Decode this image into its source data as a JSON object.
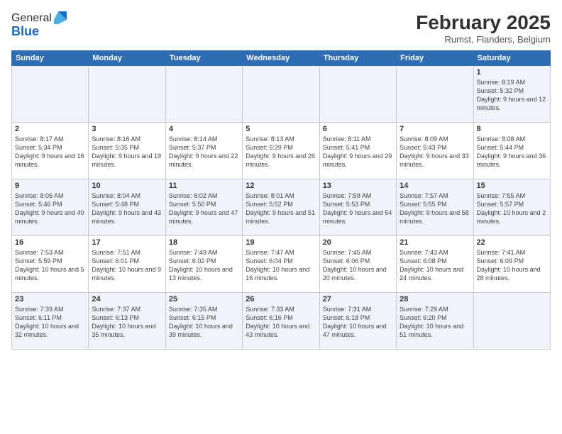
{
  "logo": {
    "general": "General",
    "blue": "Blue"
  },
  "title": "February 2025",
  "location": "Rumst, Flanders, Belgium",
  "days_of_week": [
    "Sunday",
    "Monday",
    "Tuesday",
    "Wednesday",
    "Thursday",
    "Friday",
    "Saturday"
  ],
  "weeks": [
    [
      {
        "day": "",
        "info": ""
      },
      {
        "day": "",
        "info": ""
      },
      {
        "day": "",
        "info": ""
      },
      {
        "day": "",
        "info": ""
      },
      {
        "day": "",
        "info": ""
      },
      {
        "day": "",
        "info": ""
      },
      {
        "day": "1",
        "info": "Sunrise: 8:19 AM\nSunset: 5:32 PM\nDaylight: 9 hours and 12 minutes."
      }
    ],
    [
      {
        "day": "2",
        "info": "Sunrise: 8:17 AM\nSunset: 5:34 PM\nDaylight: 9 hours and 16 minutes."
      },
      {
        "day": "3",
        "info": "Sunrise: 8:16 AM\nSunset: 5:35 PM\nDaylight: 9 hours and 19 minutes."
      },
      {
        "day": "4",
        "info": "Sunrise: 8:14 AM\nSunset: 5:37 PM\nDaylight: 9 hours and 22 minutes."
      },
      {
        "day": "5",
        "info": "Sunrise: 8:13 AM\nSunset: 5:39 PM\nDaylight: 9 hours and 26 minutes."
      },
      {
        "day": "6",
        "info": "Sunrise: 8:11 AM\nSunset: 5:41 PM\nDaylight: 9 hours and 29 minutes."
      },
      {
        "day": "7",
        "info": "Sunrise: 8:09 AM\nSunset: 5:43 PM\nDaylight: 9 hours and 33 minutes."
      },
      {
        "day": "8",
        "info": "Sunrise: 8:08 AM\nSunset: 5:44 PM\nDaylight: 9 hours and 36 minutes."
      }
    ],
    [
      {
        "day": "9",
        "info": "Sunrise: 8:06 AM\nSunset: 5:46 PM\nDaylight: 9 hours and 40 minutes."
      },
      {
        "day": "10",
        "info": "Sunrise: 8:04 AM\nSunset: 5:48 PM\nDaylight: 9 hours and 43 minutes."
      },
      {
        "day": "11",
        "info": "Sunrise: 8:02 AM\nSunset: 5:50 PM\nDaylight: 9 hours and 47 minutes."
      },
      {
        "day": "12",
        "info": "Sunrise: 8:01 AM\nSunset: 5:52 PM\nDaylight: 9 hours and 51 minutes."
      },
      {
        "day": "13",
        "info": "Sunrise: 7:59 AM\nSunset: 5:53 PM\nDaylight: 9 hours and 54 minutes."
      },
      {
        "day": "14",
        "info": "Sunrise: 7:57 AM\nSunset: 5:55 PM\nDaylight: 9 hours and 58 minutes."
      },
      {
        "day": "15",
        "info": "Sunrise: 7:55 AM\nSunset: 5:57 PM\nDaylight: 10 hours and 2 minutes."
      }
    ],
    [
      {
        "day": "16",
        "info": "Sunrise: 7:53 AM\nSunset: 5:59 PM\nDaylight: 10 hours and 5 minutes."
      },
      {
        "day": "17",
        "info": "Sunrise: 7:51 AM\nSunset: 6:01 PM\nDaylight: 10 hours and 9 minutes."
      },
      {
        "day": "18",
        "info": "Sunrise: 7:49 AM\nSunset: 6:02 PM\nDaylight: 10 hours and 13 minutes."
      },
      {
        "day": "19",
        "info": "Sunrise: 7:47 AM\nSunset: 6:04 PM\nDaylight: 10 hours and 16 minutes."
      },
      {
        "day": "20",
        "info": "Sunrise: 7:45 AM\nSunset: 6:06 PM\nDaylight: 10 hours and 20 minutes."
      },
      {
        "day": "21",
        "info": "Sunrise: 7:43 AM\nSunset: 6:08 PM\nDaylight: 10 hours and 24 minutes."
      },
      {
        "day": "22",
        "info": "Sunrise: 7:41 AM\nSunset: 6:09 PM\nDaylight: 10 hours and 28 minutes."
      }
    ],
    [
      {
        "day": "23",
        "info": "Sunrise: 7:39 AM\nSunset: 6:11 PM\nDaylight: 10 hours and 32 minutes."
      },
      {
        "day": "24",
        "info": "Sunrise: 7:37 AM\nSunset: 6:13 PM\nDaylight: 10 hours and 35 minutes."
      },
      {
        "day": "25",
        "info": "Sunrise: 7:35 AM\nSunset: 6:15 PM\nDaylight: 10 hours and 39 minutes."
      },
      {
        "day": "26",
        "info": "Sunrise: 7:33 AM\nSunset: 6:16 PM\nDaylight: 10 hours and 43 minutes."
      },
      {
        "day": "27",
        "info": "Sunrise: 7:31 AM\nSunset: 6:18 PM\nDaylight: 10 hours and 47 minutes."
      },
      {
        "day": "28",
        "info": "Sunrise: 7:29 AM\nSunset: 6:20 PM\nDaylight: 10 hours and 51 minutes."
      },
      {
        "day": "",
        "info": ""
      }
    ]
  ]
}
